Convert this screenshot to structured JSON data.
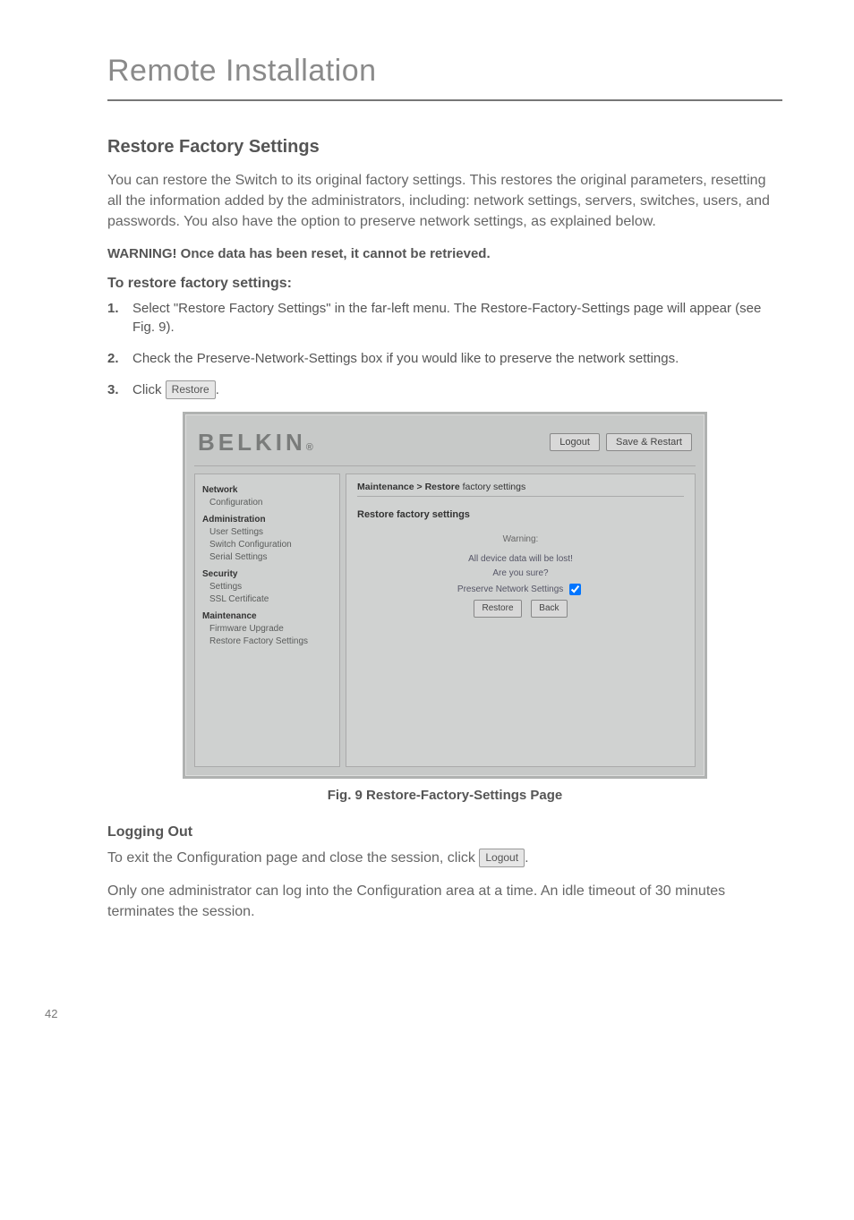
{
  "header": {
    "title": "Remote Installation"
  },
  "section": {
    "heading": "Restore Factory Settings",
    "intro": "You can restore the Switch to its original factory settings. This restores the original parameters, resetting all the information added by the administrators, including: network settings, servers, switches, users, and passwords. You also have the option to preserve network settings, as explained below.",
    "warning": "WARNING! Once data has been reset, it cannot be retrieved.",
    "subhead": "To restore factory settings:",
    "steps": {
      "s1num": "1.",
      "s1": "Select \"Restore Factory Settings\" in the far-left menu. The Restore-Factory-Settings page will appear (see Fig. 9).",
      "s2num": "2.",
      "s2": "Check the Preserve-Network-Settings box if you would like to preserve the network settings.",
      "s3num": "3.",
      "s3a": "Click ",
      "s3btn": "Restore",
      "s3b": "."
    }
  },
  "figure": {
    "brand": "BELKIN",
    "logout": "Logout",
    "save_restart": "Save & Restart",
    "sidebar": {
      "g1": "Network",
      "g1i1": "Configuration",
      "g2": "Administration",
      "g2i1": "User Settings",
      "g2i2": "Switch Configuration",
      "g2i3": "Serial Settings",
      "g3": "Security",
      "g3i1": "Settings",
      "g3i2": "SSL Certificate",
      "g4": "Maintenance",
      "g4i1": "Firmware Upgrade",
      "g4i2": "Restore Factory Settings"
    },
    "main": {
      "breadcrumb_a": "Maintenance > Restore",
      "breadcrumb_b": " factory settings",
      "panel_title": "Restore factory settings",
      "warning_label": "Warning:",
      "msg1": "All device data will be lost!",
      "msg2": "Are you sure?",
      "preserve_label": "Preserve Network Settings",
      "restore_btn": "Restore",
      "back_btn": "Back"
    },
    "caption": "Fig. 9 Restore-Factory-Settings Page"
  },
  "logging_out": {
    "heading": "Logging Out",
    "line1a": "To exit the Configuration page and close the session, click ",
    "btn": "Logout",
    "line1b": ".",
    "line2": "Only one administrator can log into the Configuration area at a time. An idle timeout of 30 minutes terminates the session."
  },
  "footer": {
    "page_num": "42"
  }
}
